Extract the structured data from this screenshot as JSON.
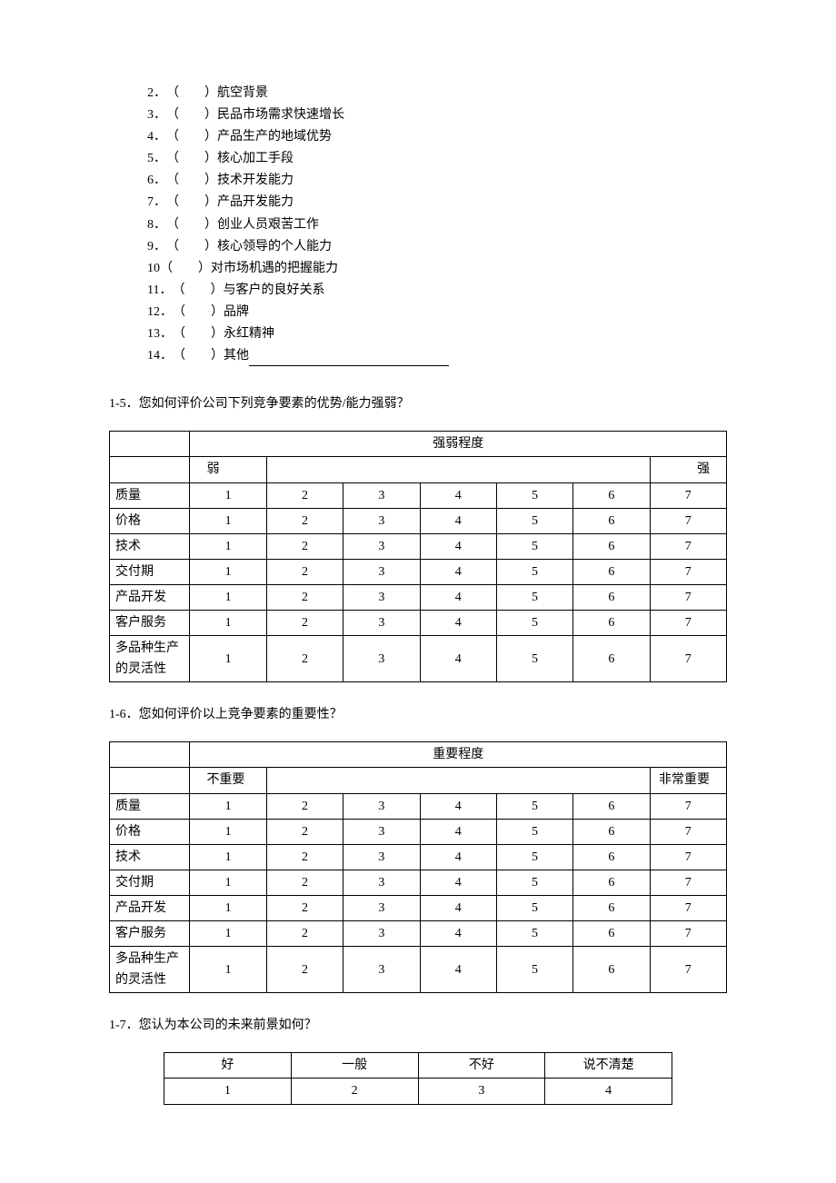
{
  "checklist": {
    "items": [
      {
        "num": "2．",
        "label": "航空背景"
      },
      {
        "num": "3．",
        "label": "民品市场需求快速增长"
      },
      {
        "num": "4．",
        "label": "产品生产的地域优势"
      },
      {
        "num": "5．",
        "label": "核心加工手段"
      },
      {
        "num": "6．",
        "label": "技术开发能力"
      },
      {
        "num": "7．",
        "label": "产品开发能力"
      },
      {
        "num": "8．",
        "label": "创业人员艰苦工作"
      },
      {
        "num": "9．",
        "label": "核心领导的个人能力"
      },
      {
        "num": "10",
        "label": "对市场机遇的把握能力"
      },
      {
        "num": "11．",
        "label": "与客户的良好关系"
      },
      {
        "num": "12．",
        "label": "品牌"
      },
      {
        "num": "13．",
        "label": "永红精神"
      },
      {
        "num": "14．",
        "label": "其他",
        "blank": true
      }
    ],
    "paren": "（　　）"
  },
  "q5": {
    "title": "1-5．您如何评价公司下列竞争要素的优势/能力强弱？",
    "header_span": "强弱程度",
    "left_end": "弱",
    "right_end": "强",
    "rows": [
      "质量",
      "价格",
      "技术",
      "交付期",
      "产品开发",
      "客户服务",
      "多品种生产的灵活性"
    ],
    "scale": [
      "1",
      "2",
      "3",
      "4",
      "5",
      "6",
      "7"
    ]
  },
  "q6": {
    "title": "1-6．您如何评价以上竞争要素的重要性？",
    "header_span": "重要程度",
    "left_end": "不重要",
    "right_end": "非常重要",
    "rows": [
      "质量",
      "价格",
      "技术",
      "交付期",
      "产品开发",
      "客户服务",
      "多品种生产的灵活性"
    ],
    "scale": [
      "1",
      "2",
      "3",
      "4",
      "5",
      "6",
      "7"
    ]
  },
  "q7": {
    "title": "1-7．您认为本公司的未来前景如何？",
    "options": [
      "好",
      "一般",
      "不好",
      "说不清楚"
    ],
    "nums": [
      "1",
      "2",
      "3",
      "4"
    ]
  }
}
